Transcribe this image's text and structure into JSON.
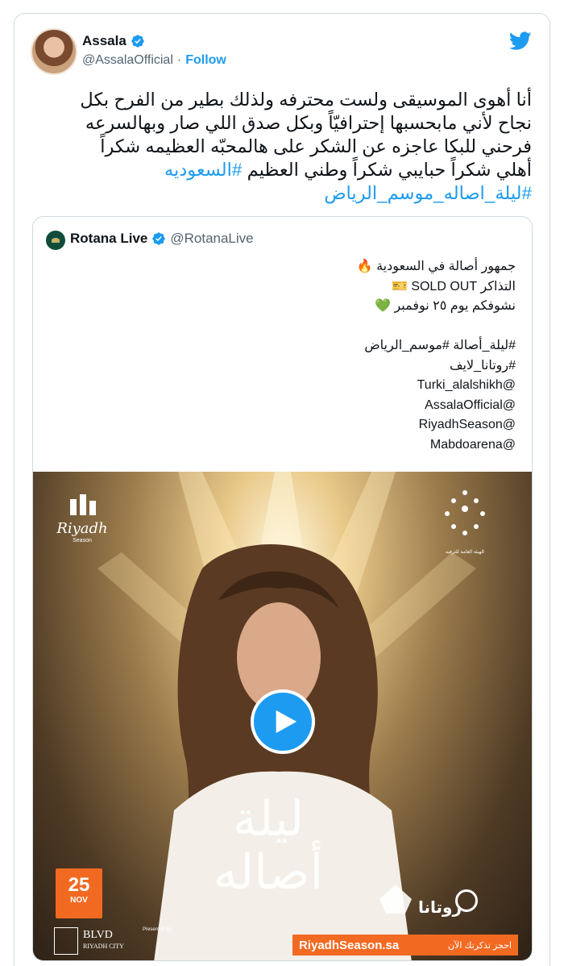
{
  "tweet": {
    "author": {
      "name": "Assala",
      "handle": "@AssalaOfficial",
      "separator": "·",
      "follow_label": "Follow"
    },
    "text": {
      "line1": "أنا أهوى الموسيقى ولست  محترفه ولذلك بطير من الفرح بكل",
      "line2": "نجاح لأني مابحسبها إحترافيّاً وبكل صدق اللي صار وبهالسرعه",
      "line3": "فرحني للبكا عاجزه عن الشكر على هالمحبّه العظيمه شكراً",
      "line4_text": "أهلي شكراً حبايبي شكراً وطني العظيم ",
      "line4_hashtag": "#السعوديه",
      "line5_hashtag": "#ليلة_اصاله_موسم_الرياض"
    }
  },
  "quote": {
    "author": {
      "name": "Rotana Live",
      "handle": "@RotanaLive"
    },
    "lines": [
      "جمهور أصالة في السعودية 🔥",
      "التذاكر SOLD OUT 🎫",
      "نشوفكم يوم ٢٥ نوفمبر 💚",
      "",
      "#ليلة_أصالة #موسم_الرياض",
      "#روتانا_لايف",
      "@Turki_alalshikh",
      "@AssalaOfficial",
      "@RiyadhSeason",
      "@Mabdoarena"
    ],
    "poster": {
      "riyadh_logo": "Riyadh",
      "riyadh_sub": "Season",
      "authority": "الهيئة العامة للترفيه",
      "title_line1": "ليلة",
      "title_line2": "أصاله",
      "date_day": "25",
      "date_month": "NOV",
      "blvd_title": "BLVD",
      "blvd_sub": "RIYADH CITY",
      "presented_by": "Presented By:",
      "rotana": "روتانا",
      "site_url": "RiyadhSeason.sa",
      "site_cta": "احجز تذكرتك الآن"
    }
  },
  "colors": {
    "accent": "#1d9bf0",
    "text": "#0f1419",
    "muted": "#536471",
    "border": "#cfd9de",
    "poster_orange": "#f26a22"
  },
  "icons": {
    "verified": "verified-badge-icon",
    "twitter": "twitter-bird-icon",
    "play": "play-icon"
  }
}
